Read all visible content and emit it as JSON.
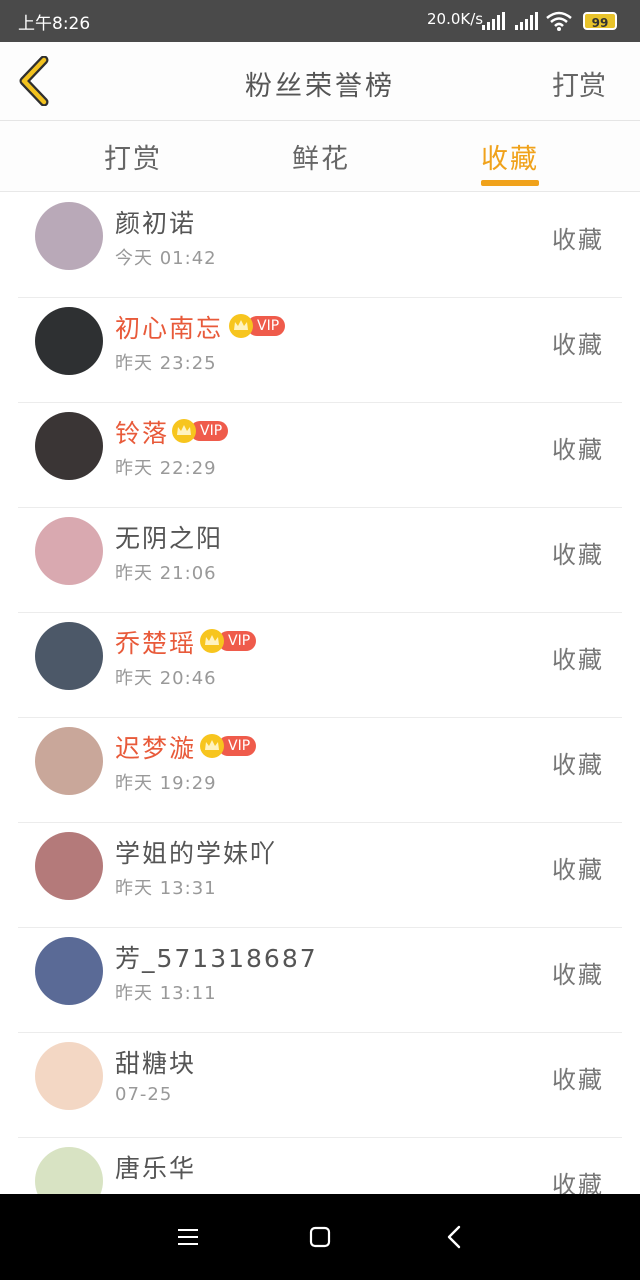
{
  "status_bar": {
    "time": "上午8:26",
    "speed": "20.0K/s",
    "battery": "99"
  },
  "header": {
    "title": "粉丝荣誉榜",
    "right_action": "打赏"
  },
  "tabs": [
    {
      "label": "打赏",
      "active": false
    },
    {
      "label": "鲜花",
      "active": false
    },
    {
      "label": "收藏",
      "active": true
    }
  ],
  "vip_label": "VIP",
  "fans": [
    {
      "name": "颜初诺",
      "time": "今天 01:42",
      "action": "收藏",
      "vip": false,
      "avatar_color": "#b9a9b8"
    },
    {
      "name": "初心南忘",
      "time": "昨天 23:25",
      "action": "收藏",
      "vip": true,
      "avatar_color": "#2e3032"
    },
    {
      "name": "铃落",
      "time": "昨天 22:29",
      "action": "收藏",
      "vip": true,
      "avatar_color": "#3a3535"
    },
    {
      "name": "无阴之阳",
      "time": "昨天 21:06",
      "action": "收藏",
      "vip": false,
      "avatar_color": "#d9a9b0"
    },
    {
      "name": "乔楚瑶",
      "time": "昨天 20:46",
      "action": "收藏",
      "vip": true,
      "avatar_color": "#4c5868"
    },
    {
      "name": "迟梦漩",
      "time": "昨天 19:29",
      "action": "收藏",
      "vip": true,
      "avatar_color": "#c9a79a"
    },
    {
      "name": "学姐的学妹吖",
      "time": "昨天 13:31",
      "action": "收藏",
      "vip": false,
      "avatar_color": "#b47a7a"
    },
    {
      "name": "芳_571318687",
      "time": "昨天 13:11",
      "action": "收藏",
      "vip": false,
      "avatar_color": "#5a6a96"
    },
    {
      "name": "甜糖块",
      "time": "07-25",
      "action": "收藏",
      "vip": false,
      "avatar_color": "#f3d7c4"
    },
    {
      "name": "唐乐华",
      "time": "",
      "action": "收藏",
      "vip": false,
      "avatar_color": "#d8e3c3"
    }
  ],
  "colors": {
    "accent": "#f0a21b",
    "vip_name": "#e85a3a",
    "vip_badge": "#ef5b4b"
  }
}
